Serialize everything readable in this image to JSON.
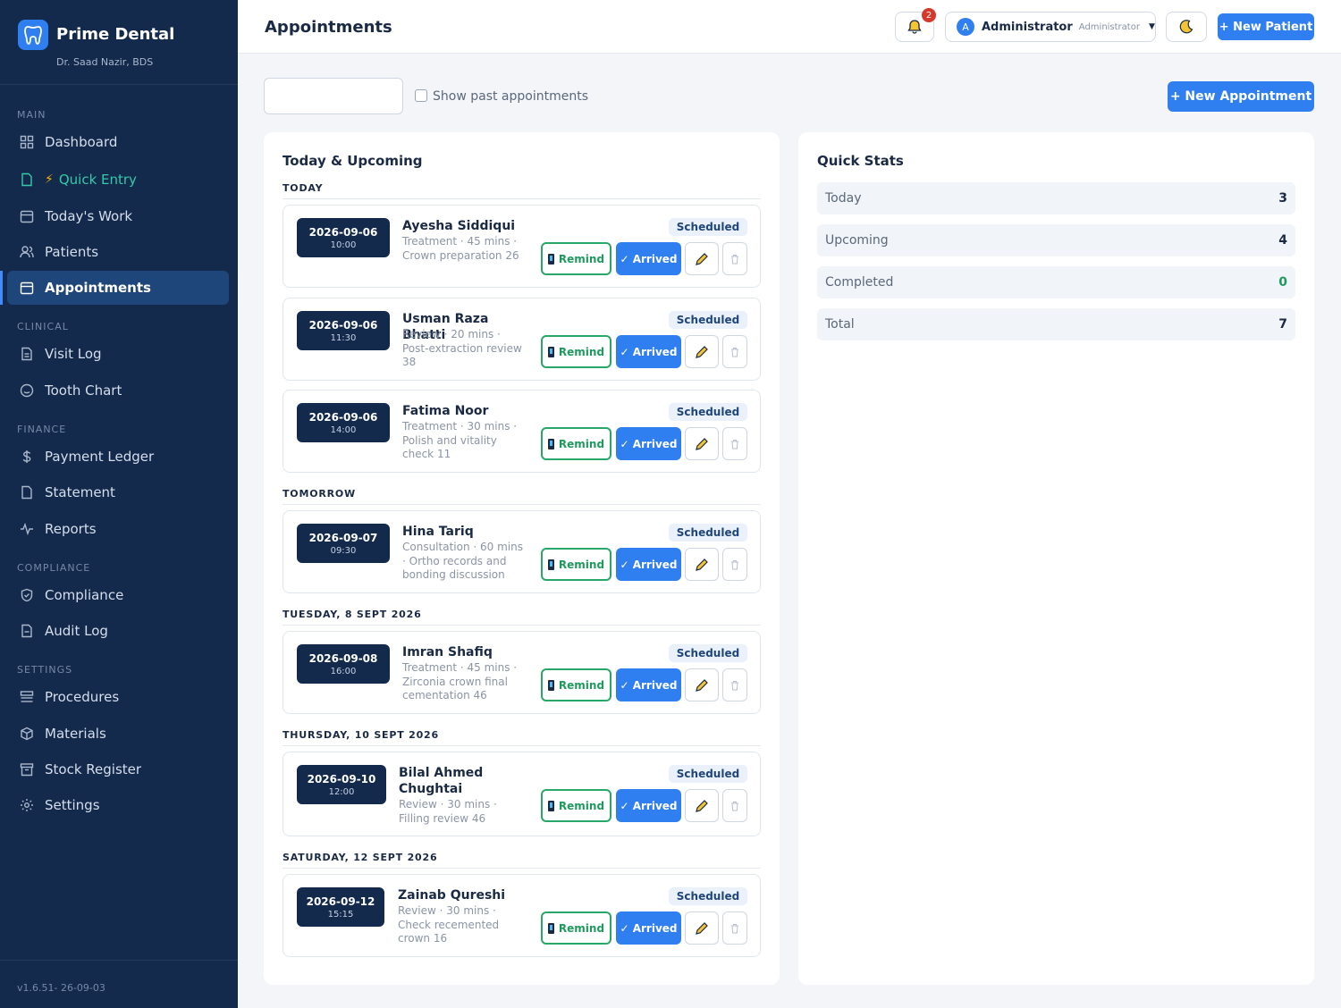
{
  "brand": {
    "name": "Prime Dental",
    "subtitle": "Dr. Saad Nazir, BDS"
  },
  "sidebar": {
    "sections": [
      "MAIN",
      "CLINICAL",
      "FINANCE",
      "COMPLIANCE",
      "SETTINGS"
    ],
    "items": [
      {
        "label": "Dashboard",
        "icon": "grid-icon"
      },
      {
        "label": "Quick Entry",
        "icon": "bolt-icon"
      },
      {
        "label": "Today's Work",
        "icon": "calendar-icon"
      },
      {
        "label": "Patients",
        "icon": "users-icon"
      },
      {
        "label": "Appointments",
        "icon": "calendar-icon",
        "active": true
      },
      {
        "label": "Visit Log",
        "icon": "document-icon"
      },
      {
        "label": "Tooth Chart",
        "icon": "circle-icon"
      },
      {
        "label": "Payment Ledger",
        "icon": "dollar-icon"
      },
      {
        "label": "Statement",
        "icon": "file-icon"
      },
      {
        "label": "Reports",
        "icon": "pulse-icon"
      },
      {
        "label": "Compliance",
        "icon": "shield-icon"
      },
      {
        "label": "Audit Log",
        "icon": "file-icon"
      },
      {
        "label": "Procedures",
        "icon": "list-icon"
      },
      {
        "label": "Materials",
        "icon": "box-icon"
      },
      {
        "label": "Stock Register",
        "icon": "archive-icon"
      },
      {
        "label": "Settings",
        "icon": "gear-icon"
      }
    ],
    "version": "v1.6.51- 26-09-03"
  },
  "header": {
    "title": "Appointments",
    "notification_count": "2",
    "user_initial": "A",
    "user_name": "Administrator",
    "user_role": "Administrator",
    "new_patient_label": "+ New Patient"
  },
  "filters": {
    "search_value": "",
    "show_past_label": "Show past appointments",
    "show_past_checked": false,
    "new_appointment_label": "+ New Appointment"
  },
  "appointments_panel": {
    "title": "Today & Upcoming",
    "groups": [
      {
        "heading": "TODAY",
        "items": [
          {
            "date": "2026-09-06",
            "time": "10:00",
            "patient": "Ayesha Siddiqui",
            "details": "Treatment · 45 mins · Crown preparation 26",
            "status": "Scheduled"
          },
          {
            "date": "2026-09-06",
            "time": "11:30",
            "patient": "Usman Raza Bhatti",
            "details": "Review · 20 mins · Post-extraction review 38",
            "status": "Scheduled"
          },
          {
            "date": "2026-09-06",
            "time": "14:00",
            "patient": "Fatima Noor",
            "details": "Treatment · 30 mins · Polish and vitality check 11",
            "status": "Scheduled"
          }
        ]
      },
      {
        "heading": "TOMORROW",
        "items": [
          {
            "date": "2026-09-07",
            "time": "09:30",
            "patient": "Hina Tariq",
            "details": "Consultation · 60 mins · Ortho records and bonding discussion",
            "status": "Scheduled"
          }
        ]
      },
      {
        "heading": "TUESDAY, 8 SEPT 2026",
        "items": [
          {
            "date": "2026-09-08",
            "time": "16:00",
            "patient": "Imran Shafiq",
            "details": "Treatment · 45 mins · Zirconia crown final cementation 46",
            "status": "Scheduled"
          }
        ]
      },
      {
        "heading": "THURSDAY, 10 SEPT 2026",
        "items": [
          {
            "date": "2026-09-10",
            "time": "12:00",
            "patient": "Bilal Ahmed Chughtai",
            "details": "Review · 30 mins · Filling review 46",
            "status": "Scheduled"
          }
        ]
      },
      {
        "heading": "SATURDAY, 12 SEPT 2026",
        "items": [
          {
            "date": "2026-09-12",
            "time": "15:15",
            "patient": "Zainab Qureshi",
            "details": "Review · 30 mins · Check recemented crown 16",
            "status": "Scheduled"
          }
        ]
      }
    ],
    "actions": {
      "remind": "Remind",
      "arrived": "✓ Arrived"
    }
  },
  "quick_stats": {
    "title": "Quick Stats",
    "rows": [
      {
        "label": "Today",
        "value": "3"
      },
      {
        "label": "Upcoming",
        "value": "4"
      },
      {
        "label": "Completed",
        "value": "0"
      },
      {
        "label": "Total",
        "value": "7"
      }
    ]
  },
  "colors": {
    "sidebar": "#132a4d",
    "accent": "#2f7ff0",
    "success": "#28a868",
    "active_nav": "#1f467a"
  }
}
